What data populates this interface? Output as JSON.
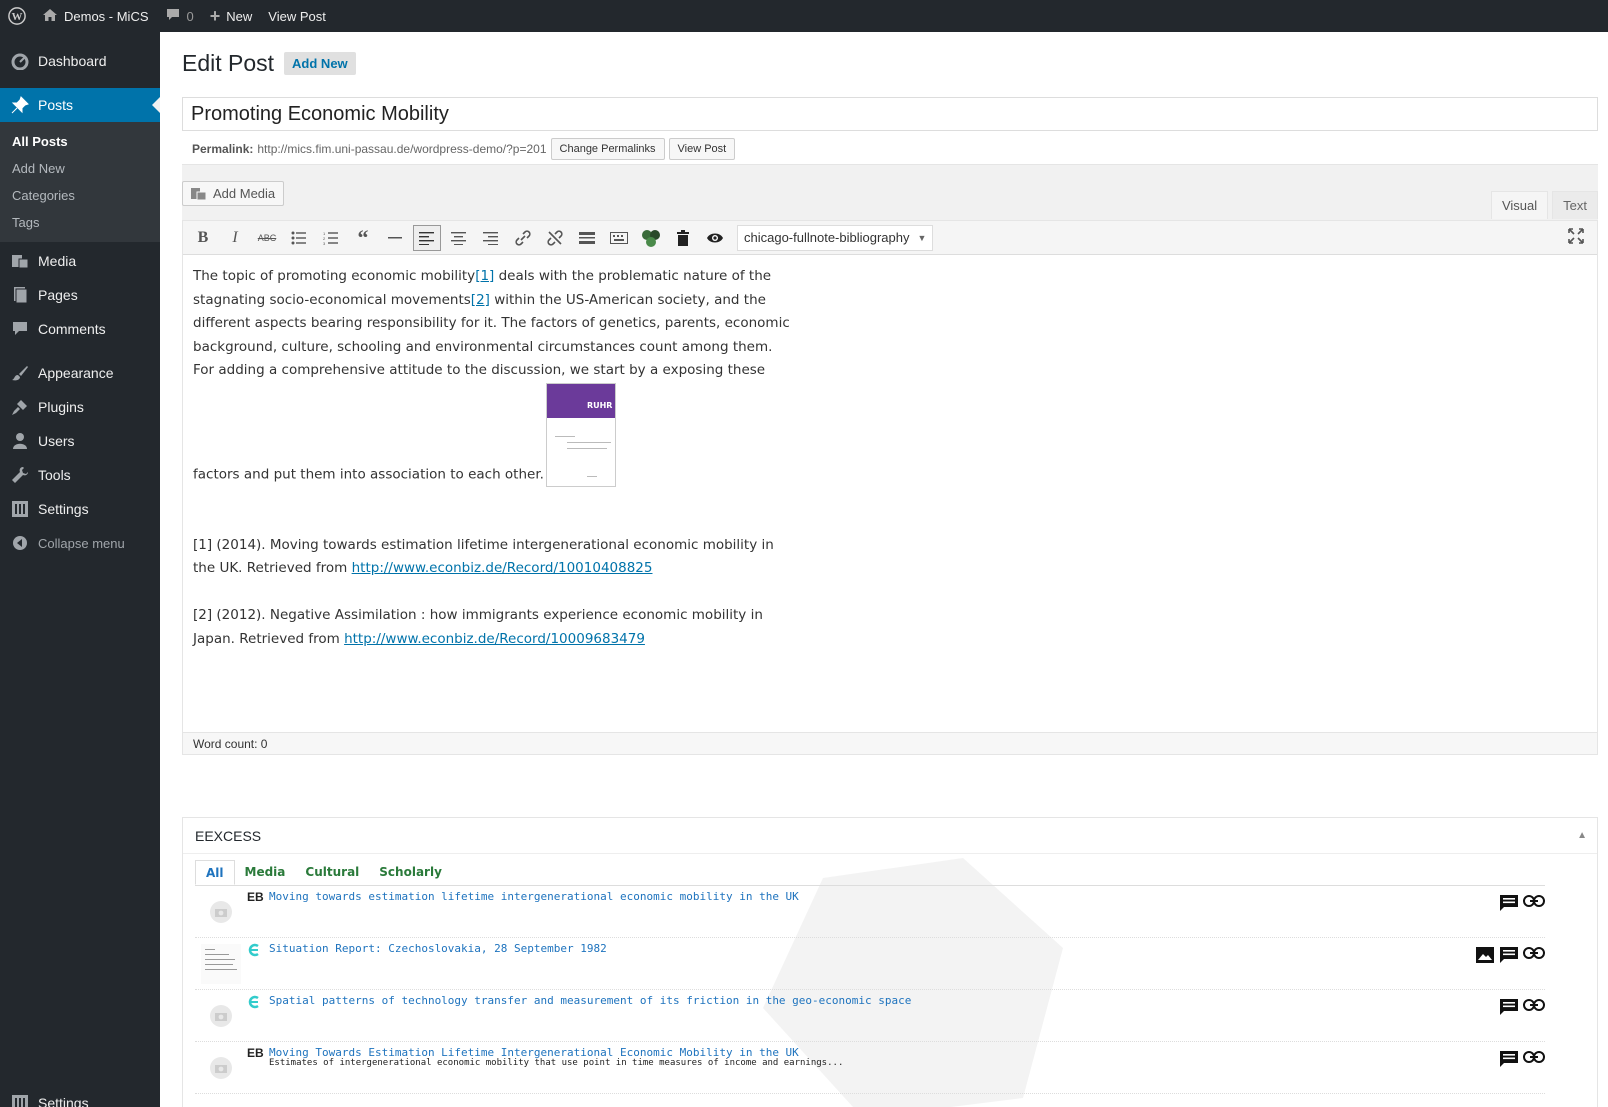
{
  "adminbar": {
    "site_name": "Demos - MiCS",
    "comments_count": "0",
    "new_label": "New",
    "view_post_label": "View Post"
  },
  "sidebar": {
    "dashboard": "Dashboard",
    "posts": "Posts",
    "posts_sub": [
      "All Posts",
      "Add New",
      "Categories",
      "Tags"
    ],
    "media": "Media",
    "pages": "Pages",
    "comments": "Comments",
    "appearance": "Appearance",
    "plugins": "Plugins",
    "users": "Users",
    "tools": "Tools",
    "settings": "Settings",
    "collapse": "Collapse menu",
    "settings_bottom": "Settings"
  },
  "page": {
    "title": "Edit Post",
    "add_new": "Add New",
    "post_title": "Promoting Economic Mobility",
    "permalink_label": "Permalink:",
    "permalink_url": "http://mics.fim.uni-passau.de/wordpress-demo/?p=201",
    "change_permalinks": "Change Permalinks",
    "view_post": "View Post"
  },
  "editor": {
    "add_media": "Add Media",
    "tab_visual": "Visual",
    "tab_text": "Text",
    "style_select": "chicago-fullnote-bibliography",
    "p1_a": "The topic of promoting economic mobility",
    "ref1": "[1]",
    "p1_b": " deals with the problematic nature of the stagnating socio-economical movements",
    "ref2": "[2]",
    "p1_c": " within the US-American society, and the different aspects bearing responsibility for it. The factors of genetics, parents, economic background, culture, schooling and environmental circumstances count among them. For adding a comprehensive attitude to the discussion, we start by a exposing these factors and put them into association to each other.",
    "thumb_label": "RUHR",
    "fn1_text": "[1] (2014). Moving towards estimation lifetime intergenerational economic mobility in the UK. Retrieved from ",
    "fn1_link": "http://www.econbiz.de/Record/10010408825",
    "fn2_text": "[2] (2012). Negative Assimilation : how immigrants experience economic mobility in Japan. Retrieved from ",
    "fn2_link": "http://www.econbiz.de/Record/10009683479",
    "word_count": "Word count: 0"
  },
  "eexcess": {
    "title": "EEXCESS",
    "tabs": [
      "All",
      "Media",
      "Cultural",
      "Scholarly"
    ],
    "results": [
      {
        "provider": "EB",
        "title": "Moving towards estimation lifetime intergenerational economic mobility in the UK",
        "snippet": ""
      },
      {
        "provider": "europeana-icon",
        "title": "Situation Report: Czechoslovakia, 28 September 1982",
        "snippet": ""
      },
      {
        "provider": "europeana-icon",
        "title": "Spatial patterns of technology transfer and measurement of its friction in the geo-economic space",
        "snippet": ""
      },
      {
        "provider": "EB",
        "title": "Moving Towards Estimation Lifetime Intergenerational Economic Mobility in the UK",
        "snippet": "Estimates of intergenerational economic mobility that use point in time measures of income and earnings..."
      }
    ]
  },
  "colors": {
    "adminbar": "#23282d",
    "active_menu": "#0073aa",
    "link": "#0073aa",
    "eexcess_tab": "#2a7a3a"
  }
}
